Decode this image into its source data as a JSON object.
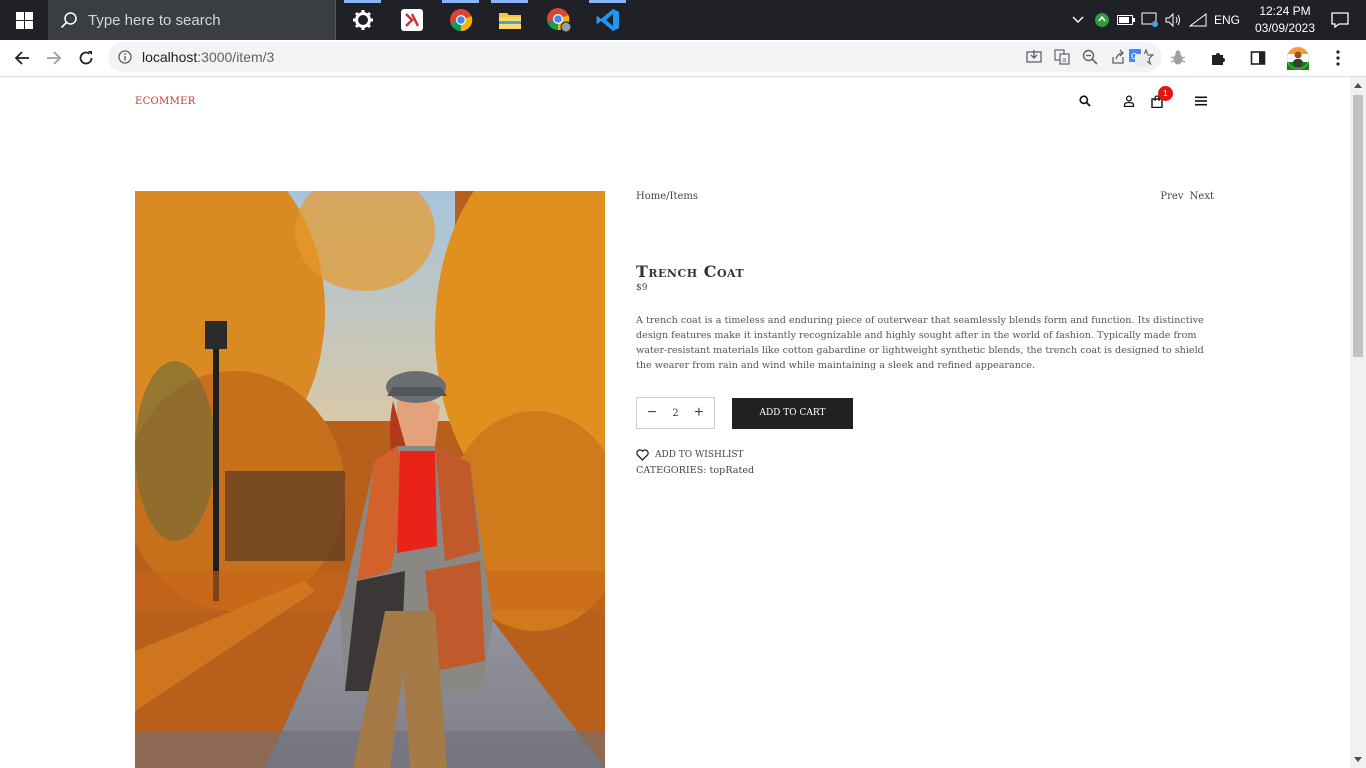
{
  "taskbar": {
    "search_placeholder": "Type here to search",
    "apps": [
      "settings-icon",
      "app-icon",
      "chrome-icon",
      "file-explorer-icon",
      "chrome-profile-icon",
      "vscode-icon"
    ],
    "language": "ENG",
    "time": "12:24 PM",
    "date": "03/09/2023"
  },
  "browser": {
    "url_host": "localhost",
    "url_path": ":3000/item/3"
  },
  "site": {
    "logo": "ECOMMER",
    "cart_count": "1"
  },
  "product": {
    "breadcrumb": "Home/Items",
    "prev": "Prev",
    "next": "Next",
    "title": "Trench Coat",
    "price": "$9",
    "description": "A trench coat is a timeless and enduring piece of outerwear that seamlessly blends form and function. Its distinctive design features make it instantly recognizable and highly sought after in the world of fashion. Typically made from water-resistant materials like cotton gabardine or lightweight synthetic blends, the trench coat is designed to shield the wearer from rain and wind while maintaining a sleek and refined appearance.",
    "quantity": "2",
    "decrement": "−",
    "increment": "+",
    "add_to_cart": "ADD TO CART",
    "wishlist": "ADD TO WISHLIST",
    "categories": "CATEGORIES: topRated"
  },
  "colors": {
    "accent": "#c0392b",
    "badge": "#e01616",
    "button": "#212121"
  }
}
